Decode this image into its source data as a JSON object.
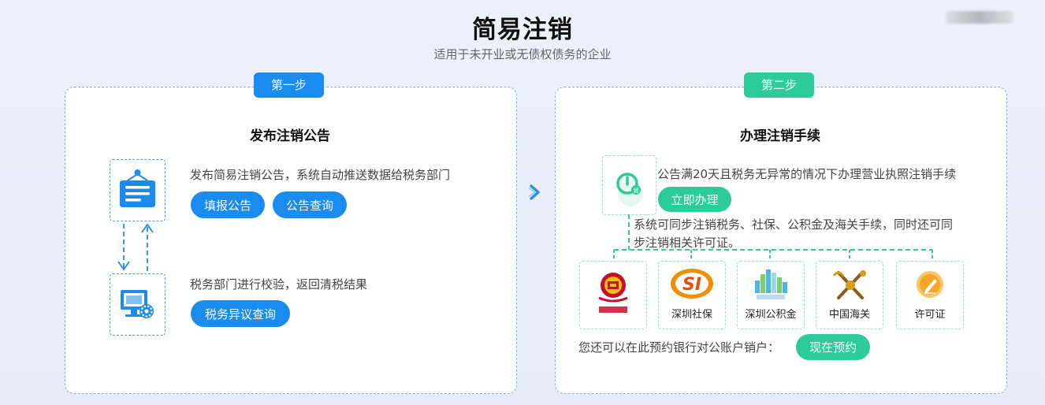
{
  "header": {
    "title": "简易注销",
    "subtitle": "适用于未开业或无债权债务的企业"
  },
  "step1": {
    "badge": "第一步",
    "title": "发布注销公告",
    "item1_text": "发布简易注销公告，系统自动推送数据给税务部门",
    "btn_fill": "填报公告",
    "btn_query": "公告查询",
    "item2_text": "税务部门进行校验，返回清税结果",
    "btn_objection": "税务异议查询"
  },
  "step2": {
    "badge": "第二步",
    "title": "办理注销手续",
    "text1": "公告满20天且税务无异常的情况下办理营业执照注销手续",
    "btn_handle": "立即办理",
    "text2_line1": "系统可同步注销税务、社保、公积金及海关手续，同时还可同",
    "text2_line2": "步注销相关许可证。",
    "logos": [
      {
        "label": "",
        "icon": "tax-bureau-emblem-icon"
      },
      {
        "label": "深圳社保",
        "icon": "social-security-logo-icon"
      },
      {
        "label": "深圳公积金",
        "icon": "housing-fund-logo-icon"
      },
      {
        "label": "中国海关",
        "icon": "customs-emblem-icon"
      },
      {
        "label": "许可证",
        "icon": "license-icon"
      }
    ],
    "bank_text": "您还可以在此预约银行对公账户销户：",
    "btn_reserve": "现在预约"
  },
  "colors": {
    "blue": "#1a8cf0",
    "green": "#2ecb9a",
    "dashed_blue": "#7ab3e6",
    "dashed_green": "#2ecb9a"
  }
}
